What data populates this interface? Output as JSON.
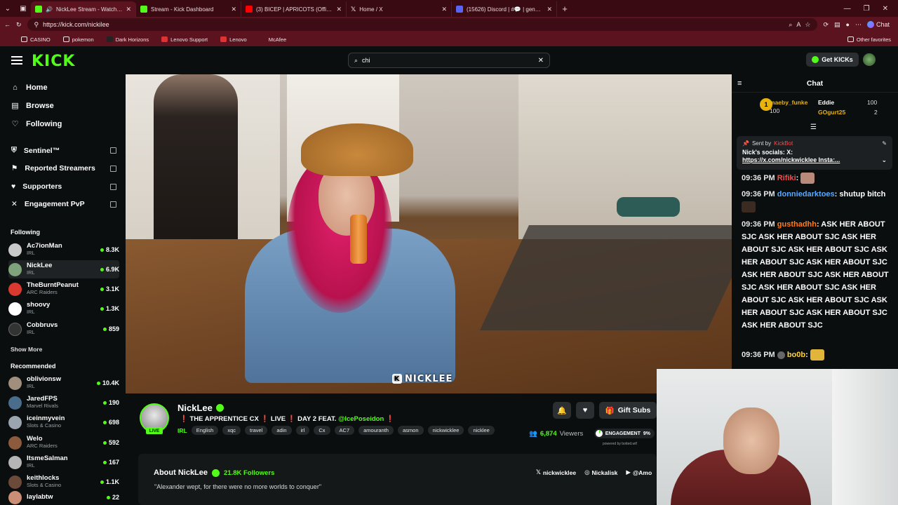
{
  "browser": {
    "tabs": [
      {
        "title": "NickLee Stream - Watch Live",
        "color": "#53fc18",
        "active": true
      },
      {
        "title": "Stream - Kick Dashboard",
        "color": "#53fc18",
        "active": false
      },
      {
        "title": "(3) BICEP | APRICOTS (Official Vide",
        "color": "#ff0000",
        "active": false
      },
      {
        "title": "Home / X",
        "color": "#000000",
        "active": false
      },
      {
        "title": "(15626) Discord | #💬 | general | C",
        "color": "#5865f2",
        "active": false
      }
    ],
    "url": "https://kick.com/nickilee",
    "chat_label": "Chat",
    "bookmarks": [
      "CASINO",
      "pokemon",
      "Dark Horizons",
      "Lenovo Support",
      "Lenovo",
      "McAfee"
    ],
    "other_favorites": "Other favorites"
  },
  "header": {
    "logo": "KICK",
    "search_value": "chi",
    "get_kicks": "Get KICKs"
  },
  "sidebar": {
    "nav": [
      "Home",
      "Browse",
      "Following"
    ],
    "extensions": [
      "Sentinel™",
      "Reported Streamers",
      "Supporters",
      "Engagement PvP"
    ],
    "following_title": "Following",
    "following": [
      {
        "name": "Ac7ionMan",
        "category": "IRL",
        "viewers": "8.3K",
        "color": "#c9c9c9"
      },
      {
        "name": "NickLee",
        "category": "IRL",
        "viewers": "6.9K",
        "color": "#7fa37a"
      },
      {
        "name": "TheBurntPeanut",
        "category": "ARC Raiders",
        "viewers": "3.1K",
        "color": "#d93a2f"
      },
      {
        "name": "shoovy",
        "category": "IRL",
        "viewers": "1.3K",
        "color": "#ffffff"
      },
      {
        "name": "Cobbruvs",
        "category": "IRL",
        "viewers": "859",
        "color": "#333333"
      }
    ],
    "show_more": "Show More",
    "recommended_title": "Recommended",
    "recommended": [
      {
        "name": "oblivionsw",
        "category": "IRL",
        "viewers": "10.4K",
        "color": "#a08f7c"
      },
      {
        "name": "JaredFPS",
        "category": "Marvel Rivals",
        "viewers": "190",
        "color": "#4a6d8c"
      },
      {
        "name": "iceinmyvein",
        "category": "Slots & Casino",
        "viewers": "698",
        "color": "#9aa5b0"
      },
      {
        "name": "Welo",
        "category": "ARC Raiders",
        "viewers": "592",
        "color": "#8c5a3c"
      },
      {
        "name": "ItsmeSalman",
        "category": "IRL",
        "viewers": "167",
        "color": "#b5b5b5"
      },
      {
        "name": "keithlocks",
        "category": "Slots & Casino",
        "viewers": "1.1K",
        "color": "#6b4a3a"
      },
      {
        "name": "laylabtw",
        "category": "",
        "viewers": "22",
        "color": "#c98e74"
      }
    ]
  },
  "video": {
    "watermark": "NICKLEE"
  },
  "chat": {
    "title": "Chat",
    "leaderboard": {
      "first": {
        "rank": "1",
        "name": "maeby_funke",
        "value": "100"
      },
      "second": {
        "name": "Eddie",
        "value": "100"
      },
      "third": {
        "name": "GOgurt25",
        "value": "2"
      }
    },
    "pinned": {
      "sent_by": "Sent by",
      "bot": "KickBot",
      "line1": "Nick's socials: X:",
      "line2": "https://x.com/nickwicklee Insta:..."
    },
    "messages": [
      {
        "time": "09:36 PM",
        "user": "Rifiki",
        "color": "#ff4a4a",
        "text": ":"
      },
      {
        "time": "09:36 PM",
        "user": "donniedarktoes",
        "color": "#5aa9ff",
        "text": ": shutup bitch"
      },
      {
        "time": "09:36 PM",
        "user": "gusthadhh",
        "color": "#ff7b1a",
        "text": ": ASK HER ABOUT SJC ASK HER ABOUT SJC ASK HER ABOUT SJC ASK HER ABOUT SJC ASK HER ABOUT SJC ASK HER ABOUT SJC ASK HER ABOUT SJC ASK HER ABOUT SJC ASK HER ABOUT SJC ASK HER ABOUT SJC ASK HER ABOUT SJC ASK HER ABOUT SJC ASK HER ABOUT SJC ASK HER ABOUT SJC"
      },
      {
        "time": "09:36 PM",
        "user": "bo0b",
        "color": "#ffd23a",
        "text": ":"
      }
    ]
  },
  "channel": {
    "name": "NickLee",
    "live": "LIVE",
    "title_prefix": "❗ THE APPRENTICE CX ❗ LIVE ❗ DAY 2 FEAT.",
    "mention": "@IcePoseidon",
    "title_suffix": "❗",
    "category": "IRL",
    "tags": [
      "English",
      "xqc",
      "travel",
      "adin",
      "irl",
      "Cx",
      "AC7",
      "amouranth",
      "asmon",
      "nickwicklee",
      "nicklee"
    ],
    "gift_subs": "Gift Subs",
    "viewers": "6,874",
    "viewers_label": "Viewers",
    "engagement_label": "ENGAGEMENT",
    "engagement_pct": "9%",
    "powered_by": "powered by botted.wtf",
    "about_title": "About NickLee",
    "followers": "21.8K Followers",
    "about_quote": "\"Alexander wept, for there were no more worlds to conquer\"",
    "socials": [
      "nickwicklee",
      "Nickalisk",
      "@Amo"
    ]
  }
}
